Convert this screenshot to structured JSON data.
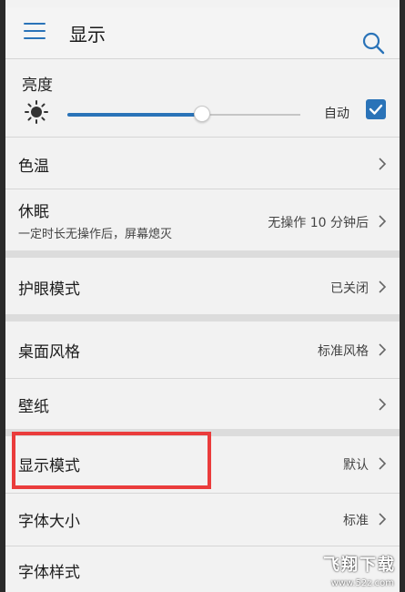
{
  "header": {
    "title": "显示"
  },
  "brightness": {
    "label": "亮度",
    "level": 0.58,
    "auto_label": "自动",
    "auto_checked": true
  },
  "rows": {
    "color_temp": {
      "label": "色温"
    },
    "sleep": {
      "label": "休眠",
      "sub": "一定时长无操作后，屏幕熄灭",
      "value": "无操作 10 分钟后"
    },
    "eye_care": {
      "label": "护眼模式",
      "value": "已关闭"
    },
    "desktop_style": {
      "label": "桌面风格",
      "value": "标准风格"
    },
    "wallpaper": {
      "label": "壁纸"
    },
    "display_mode": {
      "label": "显示模式",
      "value": "默认"
    },
    "font_size": {
      "label": "字体大小",
      "value": "标准"
    },
    "font_style": {
      "label": "字体样式"
    }
  },
  "watermark": {
    "main": "飞翔下载",
    "url": "www.52z.com"
  },
  "colors": {
    "accent": "#2a73b8",
    "highlight": "#ea3c3c"
  }
}
